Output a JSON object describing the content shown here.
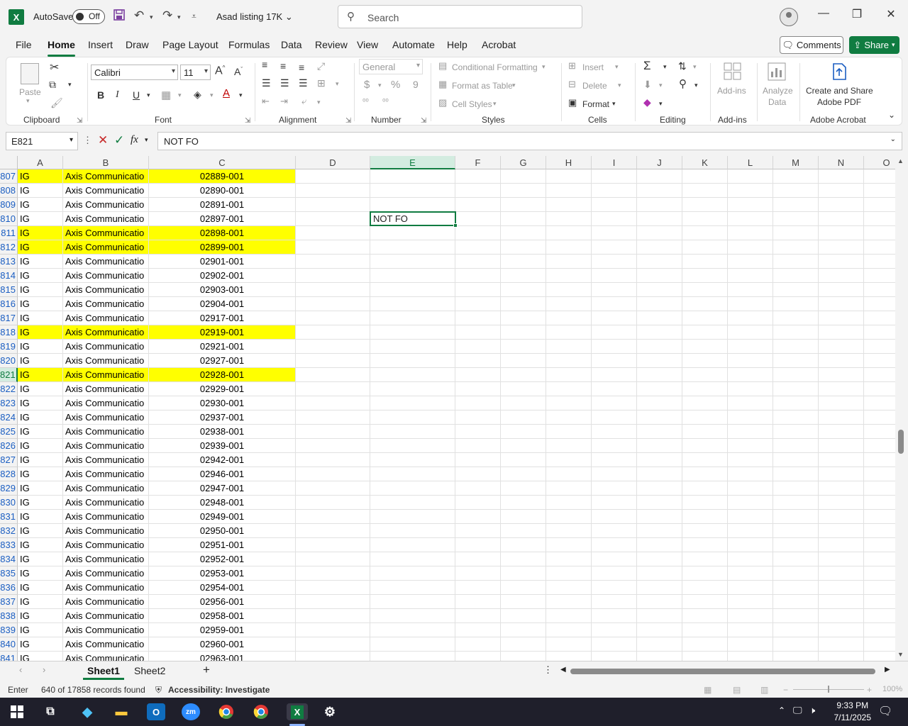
{
  "titlebar": {
    "autosave_label": "AutoSave",
    "autosave_state": "Off",
    "file_title": "Asad listing 17K",
    "search_placeholder": "Search"
  },
  "menu": {
    "tabs": [
      "File",
      "Home",
      "Insert",
      "Draw",
      "Page Layout",
      "Formulas",
      "Data",
      "Review",
      "View",
      "Automate",
      "Help",
      "Acrobat"
    ],
    "active": "Home",
    "comments_label": "Comments",
    "share_label": "Share"
  },
  "ribbon": {
    "clipboard": {
      "paste": "Paste",
      "label": "Clipboard"
    },
    "font": {
      "name": "Calibri",
      "size": "11",
      "bold": "B",
      "italic": "I",
      "underline": "U",
      "label": "Font"
    },
    "alignment": {
      "label": "Alignment"
    },
    "number": {
      "format": "General",
      "currency": "$",
      "percent": "%",
      "comma": "9",
      "label": "Number"
    },
    "styles": {
      "conditional": "Conditional Formatting",
      "format_table": "Format as Table",
      "cell_styles": "Cell Styles",
      "label": "Styles"
    },
    "cells": {
      "insert": "Insert",
      "delete": "Delete",
      "format": "Format",
      "label": "Cells"
    },
    "editing": {
      "label": "Editing"
    },
    "addins": {
      "addins": "Add-ins",
      "label": "Add-ins"
    },
    "analyze": {
      "label1": "Analyze",
      "label2": "Data"
    },
    "acrobat": {
      "create1": "Create and Share",
      "create2": "Adobe PDF",
      "label": "Adobe Acrobat"
    }
  },
  "formula_bar": {
    "name_box": "E821",
    "fx": "fx",
    "content": "NOT FO"
  },
  "grid": {
    "columns": [
      "A",
      "B",
      "C",
      "D",
      "E",
      "F",
      "G",
      "H",
      "I",
      "J",
      "K",
      "L",
      "M",
      "N",
      "O"
    ],
    "selected_column": "E",
    "rows": [
      {
        "n": "807",
        "a": "IG",
        "b": "Axis Communicatio",
        "c": "02889-001",
        "highlight": true
      },
      {
        "n": "808",
        "a": "IG",
        "b": "Axis Communicatio",
        "c": "02890-001",
        "highlight": false
      },
      {
        "n": "809",
        "a": "IG",
        "b": "Axis Communicatio",
        "c": "02891-001",
        "highlight": false
      },
      {
        "n": "810",
        "a": "IG",
        "b": "Axis Communicatio",
        "c": "02897-001",
        "highlight": false
      },
      {
        "n": "811",
        "a": "IG",
        "b": "Axis Communicatio",
        "c": "02898-001",
        "highlight": true
      },
      {
        "n": "812",
        "a": "IG",
        "b": "Axis Communicatio",
        "c": "02899-001",
        "highlight": true
      },
      {
        "n": "813",
        "a": "IG",
        "b": "Axis Communicatio",
        "c": "02901-001",
        "highlight": false
      },
      {
        "n": "814",
        "a": "IG",
        "b": "Axis Communicatio",
        "c": "02902-001",
        "highlight": false
      },
      {
        "n": "815",
        "a": "IG",
        "b": "Axis Communicatio",
        "c": "02903-001",
        "highlight": false
      },
      {
        "n": "816",
        "a": "IG",
        "b": "Axis Communicatio",
        "c": "02904-001",
        "highlight": false
      },
      {
        "n": "817",
        "a": "IG",
        "b": "Axis Communicatio",
        "c": "02917-001",
        "highlight": false
      },
      {
        "n": "818",
        "a": "IG",
        "b": "Axis Communicatio",
        "c": "02919-001",
        "highlight": true
      },
      {
        "n": "819",
        "a": "IG",
        "b": "Axis Communicatio",
        "c": "02921-001",
        "highlight": false
      },
      {
        "n": "820",
        "a": "IG",
        "b": "Axis Communicatio",
        "c": "02927-001",
        "highlight": false
      },
      {
        "n": "821",
        "a": "IG",
        "b": "Axis Communicatio",
        "c": "02928-001",
        "highlight": true,
        "selected": true,
        "e": "NOT FO"
      },
      {
        "n": "822",
        "a": "IG",
        "b": "Axis Communicatio",
        "c": "02929-001",
        "highlight": false
      },
      {
        "n": "823",
        "a": "IG",
        "b": "Axis Communicatio",
        "c": "02930-001",
        "highlight": false
      },
      {
        "n": "824",
        "a": "IG",
        "b": "Axis Communicatio",
        "c": "02937-001",
        "highlight": false
      },
      {
        "n": "825",
        "a": "IG",
        "b": "Axis Communicatio",
        "c": "02938-001",
        "highlight": false
      },
      {
        "n": "826",
        "a": "IG",
        "b": "Axis Communicatio",
        "c": "02939-001",
        "highlight": false
      },
      {
        "n": "827",
        "a": "IG",
        "b": "Axis Communicatio",
        "c": "02942-001",
        "highlight": false
      },
      {
        "n": "828",
        "a": "IG",
        "b": "Axis Communicatio",
        "c": "02946-001",
        "highlight": false
      },
      {
        "n": "829",
        "a": "IG",
        "b": "Axis Communicatio",
        "c": "02947-001",
        "highlight": false
      },
      {
        "n": "830",
        "a": "IG",
        "b": "Axis Communicatio",
        "c": "02948-001",
        "highlight": false
      },
      {
        "n": "831",
        "a": "IG",
        "b": "Axis Communicatio",
        "c": "02949-001",
        "highlight": false
      },
      {
        "n": "832",
        "a": "IG",
        "b": "Axis Communicatio",
        "c": "02950-001",
        "highlight": false
      },
      {
        "n": "833",
        "a": "IG",
        "b": "Axis Communicatio",
        "c": "02951-001",
        "highlight": false
      },
      {
        "n": "834",
        "a": "IG",
        "b": "Axis Communicatio",
        "c": "02952-001",
        "highlight": false
      },
      {
        "n": "835",
        "a": "IG",
        "b": "Axis Communicatio",
        "c": "02953-001",
        "highlight": false
      },
      {
        "n": "836",
        "a": "IG",
        "b": "Axis Communicatio",
        "c": "02954-001",
        "highlight": false
      },
      {
        "n": "837",
        "a": "IG",
        "b": "Axis Communicatio",
        "c": "02956-001",
        "highlight": false
      },
      {
        "n": "838",
        "a": "IG",
        "b": "Axis Communicatio",
        "c": "02958-001",
        "highlight": false
      },
      {
        "n": "839",
        "a": "IG",
        "b": "Axis Communicatio",
        "c": "02959-001",
        "highlight": false
      },
      {
        "n": "840",
        "a": "IG",
        "b": "Axis Communicatio",
        "c": "02960-001",
        "highlight": false
      },
      {
        "n": "841",
        "a": "IG",
        "b": "Axis Communicatio",
        "c": "02963-001",
        "highlight": false
      }
    ],
    "active_cell_value": "NOT FO"
  },
  "sheets": {
    "tabs": [
      "Sheet1",
      "Sheet2"
    ],
    "active": "Sheet1"
  },
  "status": {
    "mode": "Enter",
    "records": "640 of 17858 records found",
    "accessibility": "Accessibility: Investigate",
    "zoom": "100%"
  },
  "taskbar": {
    "time": "9:33 PM",
    "date": "7/11/2025"
  },
  "colors": {
    "excel_green": "#107c41",
    "highlight_yellow": "#ffff00",
    "row_number_blue": "#1b5ec2"
  }
}
